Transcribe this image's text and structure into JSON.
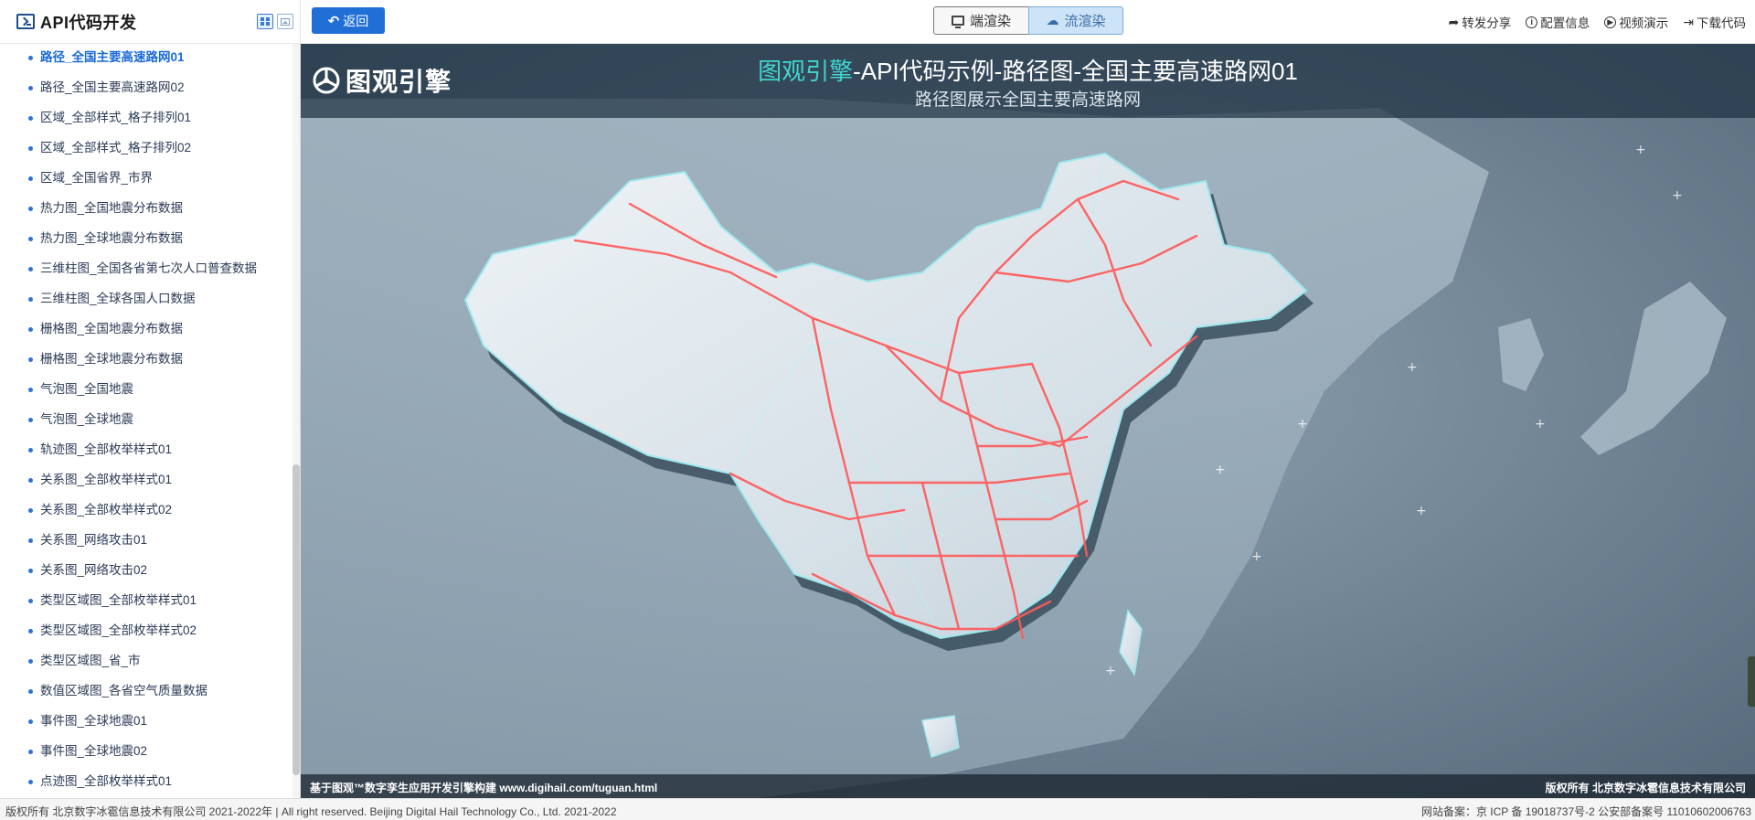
{
  "sidebar": {
    "title": "API代码开发",
    "items": [
      {
        "label": "路径_全国主要高速路网01",
        "active": true
      },
      {
        "label": "路径_全国主要高速路网02"
      },
      {
        "label": "区域_全部样式_格子排列01"
      },
      {
        "label": "区域_全部样式_格子排列02"
      },
      {
        "label": "区域_全国省界_市界"
      },
      {
        "label": "热力图_全国地震分布数据"
      },
      {
        "label": "热力图_全球地震分布数据"
      },
      {
        "label": "三维柱图_全国各省第七次人口普查数据"
      },
      {
        "label": "三维柱图_全球各国人口数据"
      },
      {
        "label": "栅格图_全国地震分布数据"
      },
      {
        "label": "栅格图_全球地震分布数据"
      },
      {
        "label": "气泡图_全国地震"
      },
      {
        "label": "气泡图_全球地震"
      },
      {
        "label": "轨迹图_全部枚举样式01"
      },
      {
        "label": "关系图_全部枚举样式01"
      },
      {
        "label": "关系图_全部枚举样式02"
      },
      {
        "label": "关系图_网络攻击01"
      },
      {
        "label": "关系图_网络攻击02"
      },
      {
        "label": "类型区域图_全部枚举样式01"
      },
      {
        "label": "类型区域图_全部枚举样式02"
      },
      {
        "label": "类型区域图_省_市"
      },
      {
        "label": "数值区域图_各省空气质量数据"
      },
      {
        "label": "事件图_全球地震01"
      },
      {
        "label": "事件图_全球地震02"
      },
      {
        "label": "点迹图_全部枚举样式01"
      }
    ]
  },
  "toolbar": {
    "back_label": "返回",
    "client_render_label": "端渲染",
    "stream_render_label": "流渲染",
    "share_label": "转发分享",
    "config_label": "配置信息",
    "video_label": "视频演示",
    "download_label": "下载代码"
  },
  "scene": {
    "brand": "图观引擎",
    "title_accent": "图观引擎",
    "title_rest": "-API代码示例-路径图-全国主要高速路网01",
    "subtitle": "路径图展示全国主要高速路网",
    "built_with": "基于图观™数字孪生应用开发引擎构建 www.digihail.com/tuguan.html",
    "copyright": "版权所有 北京数字冰雹信息技术有限公司"
  },
  "footer": {
    "left": "版权所有 北京数字冰雹信息技术有限公司 2021-2022年 | All right reserved. Beijing Digital Hail Technology Co., Ltd. 2021-2022",
    "right": "网站备案：京 ICP 备 19018737号-2 公安部备案号 11010602006763"
  },
  "colors": {
    "accent_blue": "#1f6fd6",
    "title_cyan": "#3fd6d0",
    "route_red": "#ff5a5a"
  },
  "icons": [
    "terminal-icon",
    "grid-view-icon",
    "image-view-icon",
    "back-arrow-icon",
    "monitor-icon",
    "cloud-icon",
    "share-icon",
    "info-icon",
    "play-icon",
    "download-icon",
    "chevron-left-icon"
  ]
}
